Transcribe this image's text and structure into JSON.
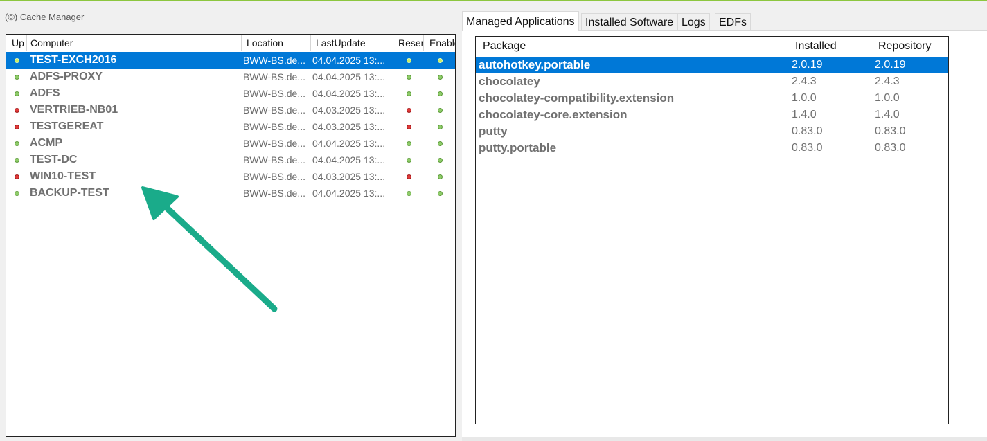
{
  "caption": "(©) Cache Manager",
  "left_list": {
    "columns": [
      "Up",
      "Computer",
      "Location",
      "LastUpdate",
      "Resen",
      "Enable"
    ],
    "rows": [
      {
        "up": "green",
        "computer": "TEST-EXCH2016",
        "location": "BWW-BS.de...",
        "last_update": "04.04.2025 13:...",
        "resend": "green",
        "enabled": "green",
        "selected": true
      },
      {
        "up": "green",
        "computer": "ADFS-PROXY",
        "location": "BWW-BS.de...",
        "last_update": "04.04.2025 13:...",
        "resend": "green",
        "enabled": "green",
        "selected": false
      },
      {
        "up": "green",
        "computer": "ADFS",
        "location": "BWW-BS.de...",
        "last_update": "04.04.2025 13:...",
        "resend": "green",
        "enabled": "green",
        "selected": false
      },
      {
        "up": "red",
        "computer": "VERTRIEB-NB01",
        "location": "BWW-BS.de...",
        "last_update": "04.03.2025 13:...",
        "resend": "red",
        "enabled": "green",
        "selected": false
      },
      {
        "up": "red",
        "computer": "TESTGEREAT",
        "location": "BWW-BS.de...",
        "last_update": "04.03.2025 13:...",
        "resend": "red",
        "enabled": "green",
        "selected": false
      },
      {
        "up": "green",
        "computer": "ACMP",
        "location": "BWW-BS.de...",
        "last_update": "04.04.2025 13:...",
        "resend": "green",
        "enabled": "green",
        "selected": false
      },
      {
        "up": "green",
        "computer": "TEST-DC",
        "location": "BWW-BS.de...",
        "last_update": "04.04.2025 13:...",
        "resend": "green",
        "enabled": "green",
        "selected": false
      },
      {
        "up": "red",
        "computer": "WIN10-TEST",
        "location": "BWW-BS.de...",
        "last_update": "04.03.2025 13:...",
        "resend": "red",
        "enabled": "green",
        "selected": false
      },
      {
        "up": "green",
        "computer": "BACKUP-TEST",
        "location": "BWW-BS.de...",
        "last_update": "04.04.2025 13:...",
        "resend": "green",
        "enabled": "green",
        "selected": false
      }
    ]
  },
  "tabs": [
    {
      "label": "Managed Applications",
      "active": true
    },
    {
      "label": "Installed Software",
      "active": false
    },
    {
      "label": "Logs",
      "active": false
    },
    {
      "label": "EDFs",
      "active": false
    }
  ],
  "packages": {
    "columns": [
      "Package",
      "Installed",
      "Repository"
    ],
    "rows": [
      {
        "package": "autohotkey.portable",
        "installed": "2.0.19",
        "repository": "2.0.19",
        "selected": true
      },
      {
        "package": "chocolatey",
        "installed": "2.4.3",
        "repository": "2.4.3",
        "selected": false
      },
      {
        "package": "chocolatey-compatibility.extension",
        "installed": "1.0.0",
        "repository": "1.0.0",
        "selected": false
      },
      {
        "package": "chocolatey-core.extension",
        "installed": "1.4.0",
        "repository": "1.4.0",
        "selected": false
      },
      {
        "package": "putty",
        "installed": "0.83.0",
        "repository": "0.83.0",
        "selected": false
      },
      {
        "package": "putty.portable",
        "installed": "0.83.0",
        "repository": "0.83.0",
        "selected": false
      }
    ]
  },
  "colors": {
    "selection": "#0078d7",
    "status_green": "#8fcc6a",
    "status_red": "#e03a3a",
    "arrow": "#1aab8a",
    "accent_line": "#8cc63f"
  },
  "icons": [
    "status-dot-icon",
    "annotation-arrow-icon"
  ]
}
